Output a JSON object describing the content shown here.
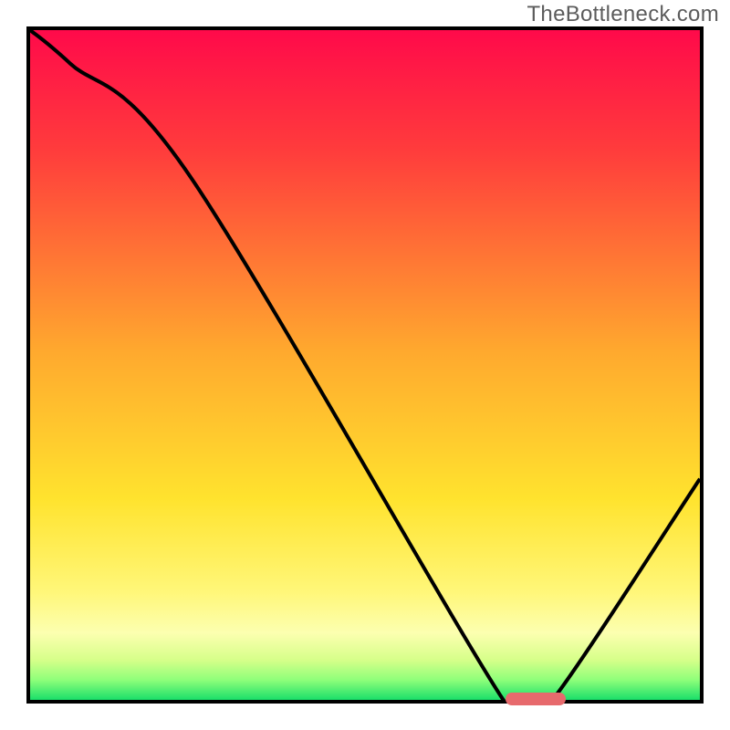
{
  "watermark": "TheBottleneck.com",
  "chart_data": {
    "type": "line",
    "title": "",
    "xlabel": "",
    "ylabel": "",
    "xlim": [
      0,
      100
    ],
    "ylim": [
      0,
      100
    ],
    "x": [
      0,
      6,
      24,
      70,
      74,
      78,
      100
    ],
    "values": [
      100,
      95,
      78,
      1,
      0,
      0,
      33
    ],
    "min_region": {
      "x_start": 71,
      "x_end": 80,
      "y": 0
    },
    "background_gradient": {
      "stops": [
        {
          "pct": 0,
          "color": "#ff0a4a"
        },
        {
          "pct": 18,
          "color": "#ff3c3c"
        },
        {
          "pct": 48,
          "color": "#ffa92e"
        },
        {
          "pct": 70,
          "color": "#ffe32e"
        },
        {
          "pct": 84,
          "color": "#fff77a"
        },
        {
          "pct": 90,
          "color": "#fcffb0"
        },
        {
          "pct": 94,
          "color": "#d7ff8a"
        },
        {
          "pct": 97,
          "color": "#8fff7a"
        },
        {
          "pct": 100,
          "color": "#1adf6a"
        }
      ]
    }
  }
}
